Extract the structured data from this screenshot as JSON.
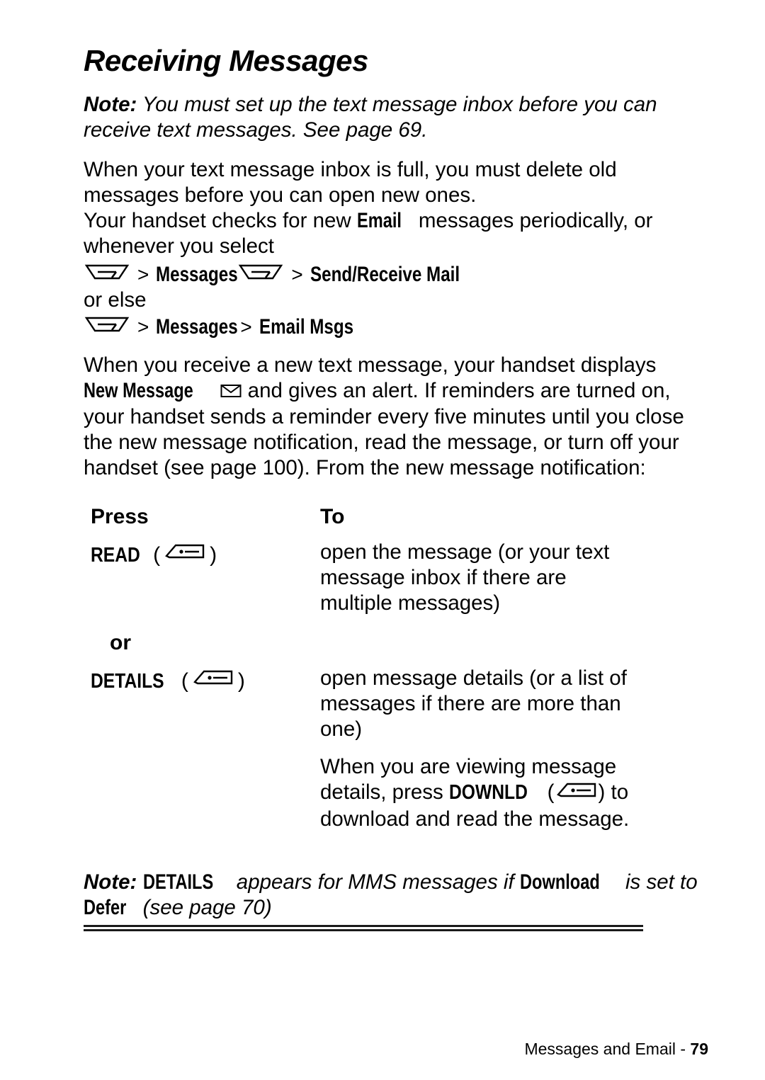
{
  "document": {
    "title": "Receiving Messages",
    "note1": {
      "label": "Note:",
      "text": " You must set up the text message inbox before you can receive text messages. See page 69."
    },
    "paragraph1": "When your text message inbox is full, you must delete old messages before you can open new ones.",
    "paragraph2_part1": "Your handset checks for new ",
    "paragraph2_lcd": "Email",
    "paragraph2_part2": " messages periodically, or whenever you select",
    "menupath1": {
      "key_icon": "menu-key-icon",
      "sep1": ">",
      "item1": "Messages",
      "key_icon2": "menu-key-icon",
      "sep2": ">",
      "item2": "Send/Receive Mail"
    },
    "orelse": "or else",
    "menupath2": {
      "key_icon": "menu-key-icon",
      "sep1": ">",
      "item1": "Messages",
      "sep2": ">",
      "item2": "Email Msgs"
    },
    "paragraph3_part1": "When you receive a new text message, your handset displays ",
    "paragraph3_lcd1": "New Message",
    "paragraph3_part2": " and gives an alert. If reminders are turned on, your handset sends a reminder every five minutes until you close the new message notification, read the message, or turn off your handset (see page 100). From the new message notification:",
    "table": {
      "header_press": "Press",
      "header_to": "To",
      "rows": [
        {
          "press_label": "READ",
          "press_key": "soft-key-left-icon",
          "to": "open the message (or your text message inbox if there are multiple messages)"
        },
        {
          "press_label": "or",
          "press_key": "",
          "to": ""
        },
        {
          "press_label": "DETAILS",
          "press_key": "soft-key-left-icon",
          "to": "open message details (or a list of messages if there are more than one)"
        }
      ],
      "extra_note_part1": "When you are viewing message details, press ",
      "extra_note_cmd": "DOWNLD",
      "extra_note_key": "soft-key-left-icon",
      "extra_note_part2": " to download and read the message."
    },
    "note2": {
      "label": "Note:",
      "cmd1": "DETAILS",
      "text1": " appears for MMS messages if ",
      "cmd2": "Download",
      "text2": " is set to ",
      "cmd3": "Defer",
      "text3": " (see page 70)"
    },
    "footer": {
      "text": "Messages and Email - ",
      "page": "79"
    }
  }
}
